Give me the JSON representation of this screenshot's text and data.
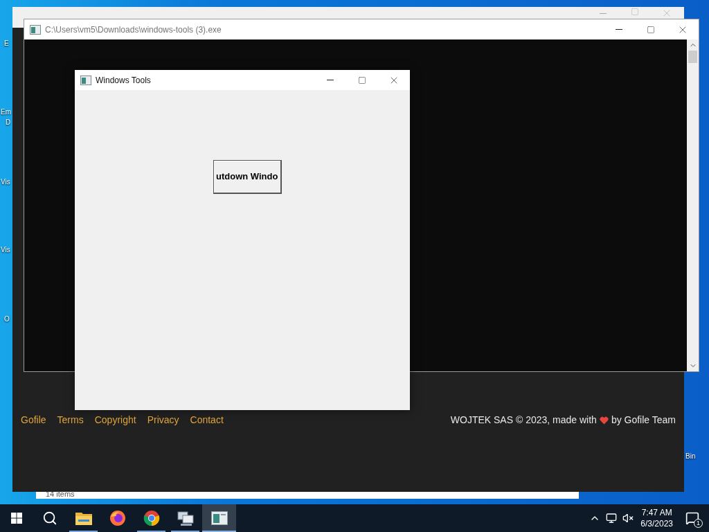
{
  "desktop": {
    "icon_labels": [
      "E",
      "Em",
      "D",
      "Vis",
      "Vis",
      "O",
      "Bin"
    ]
  },
  "explorer_window": {
    "status": "14 items"
  },
  "browser_window": {
    "footer_links": [
      "Gofile",
      "Terms",
      "Copyright",
      "Privacy",
      "Contact"
    ],
    "credit_before": "WOJTEK SAS © 2023, made with",
    "credit_after": "by Gofile Team"
  },
  "console_window": {
    "title": "C:\\Users\\vm5\\Downloads\\windows-tools (3).exe"
  },
  "tool_window": {
    "title": "Windows Tools",
    "button": "utdown Windo"
  },
  "taskbar": {
    "apps": [
      {
        "kind": "folder",
        "running": true,
        "selected": false
      },
      {
        "kind": "firefox",
        "running": false,
        "selected": false
      },
      {
        "kind": "chrome",
        "running": true,
        "selected": false
      },
      {
        "kind": "network",
        "running": true,
        "selected": false
      },
      {
        "kind": "console",
        "running": true,
        "selected": true
      }
    ],
    "time": "7:47 AM",
    "date": "6/3/2023",
    "notification_count": "1"
  }
}
